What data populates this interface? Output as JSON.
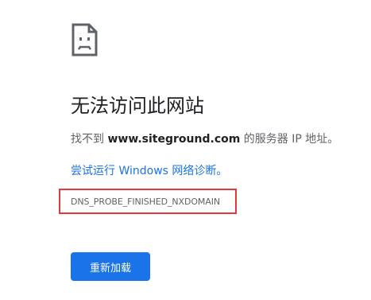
{
  "icon": "sad-page-icon",
  "title": "无法访问此网站",
  "message": {
    "prefix": "找不到 ",
    "domain": "www.siteground.com",
    "suffix": " 的服务器 IP 地址。"
  },
  "diagnose_link": "尝试运行 Windows 网络诊断。",
  "error_code": "DNS_PROBE_FINISHED_NXDOMAIN",
  "reload_button": "重新加载",
  "colors": {
    "title": "#202124",
    "text": "#5f6368",
    "link": "#1a73e8",
    "button": "#1a73e8",
    "highlight_border": "#e2393f"
  }
}
